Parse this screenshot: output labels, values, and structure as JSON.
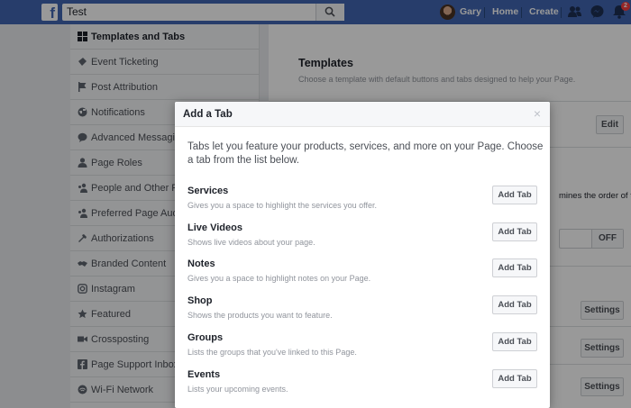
{
  "topbar": {
    "logo": "f",
    "search_value": "Test",
    "user_name": "Gary",
    "home_label": "Home",
    "create_label": "Create",
    "notification_count": "2"
  },
  "sidebar": {
    "items": [
      {
        "label": "Templates and Tabs",
        "icon": "grid-icon"
      },
      {
        "label": "Event Ticketing",
        "icon": "ticket-icon"
      },
      {
        "label": "Post Attribution",
        "icon": "flag-icon"
      },
      {
        "label": "Notifications",
        "icon": "globe-icon"
      },
      {
        "label": "Advanced Messaging",
        "icon": "message-icon"
      },
      {
        "label": "Page Roles",
        "icon": "person-icon"
      },
      {
        "label": "People and Other Pages",
        "icon": "people-icon"
      },
      {
        "label": "Preferred Page Audience",
        "icon": "people-icon"
      },
      {
        "label": "Authorizations",
        "icon": "wrench-icon"
      },
      {
        "label": "Branded Content",
        "icon": "handshake-icon"
      },
      {
        "label": "Instagram",
        "icon": "instagram-icon"
      },
      {
        "label": "Featured",
        "icon": "star-icon"
      },
      {
        "label": "Crossposting",
        "icon": "video-icon"
      },
      {
        "label": "Page Support Inbox",
        "icon": "facebook-icon"
      },
      {
        "label": "Wi-Fi Network",
        "icon": "wifi-icon"
      }
    ]
  },
  "content": {
    "title": "Templates",
    "subtitle": "Choose a template with default buttons and tabs designed to help your Page.",
    "edit_label": "Edit",
    "order_text": "mines the order of the",
    "toggle_label": "OFF",
    "settings_label": "Settings"
  },
  "modal": {
    "title": "Add a Tab",
    "close": "×",
    "intro": "Tabs let you feature your products, services, and more on your Page. Choose a tab from the list below.",
    "tabs": [
      {
        "name": "Services",
        "description": "Gives you a space to highlight the services you offer.",
        "button": "Add Tab"
      },
      {
        "name": "Live Videos",
        "description": "Shows live videos about your page.",
        "button": "Add Tab"
      },
      {
        "name": "Notes",
        "description": "Gives you a space to highlight notes on your Page.",
        "button": "Add Tab"
      },
      {
        "name": "Shop",
        "description": "Shows the products you want to feature.",
        "button": "Add Tab"
      },
      {
        "name": "Groups",
        "description": "Lists the groups that you've linked to this Page.",
        "button": "Add Tab"
      },
      {
        "name": "Events",
        "description": "Lists your upcoming events.",
        "button": "Add Tab"
      }
    ]
  },
  "colors": {
    "brand_blue": "#4267b2",
    "sidebar_bg": "#f6f7f9",
    "text_primary": "#1d2129",
    "text_secondary": "#90949c"
  }
}
